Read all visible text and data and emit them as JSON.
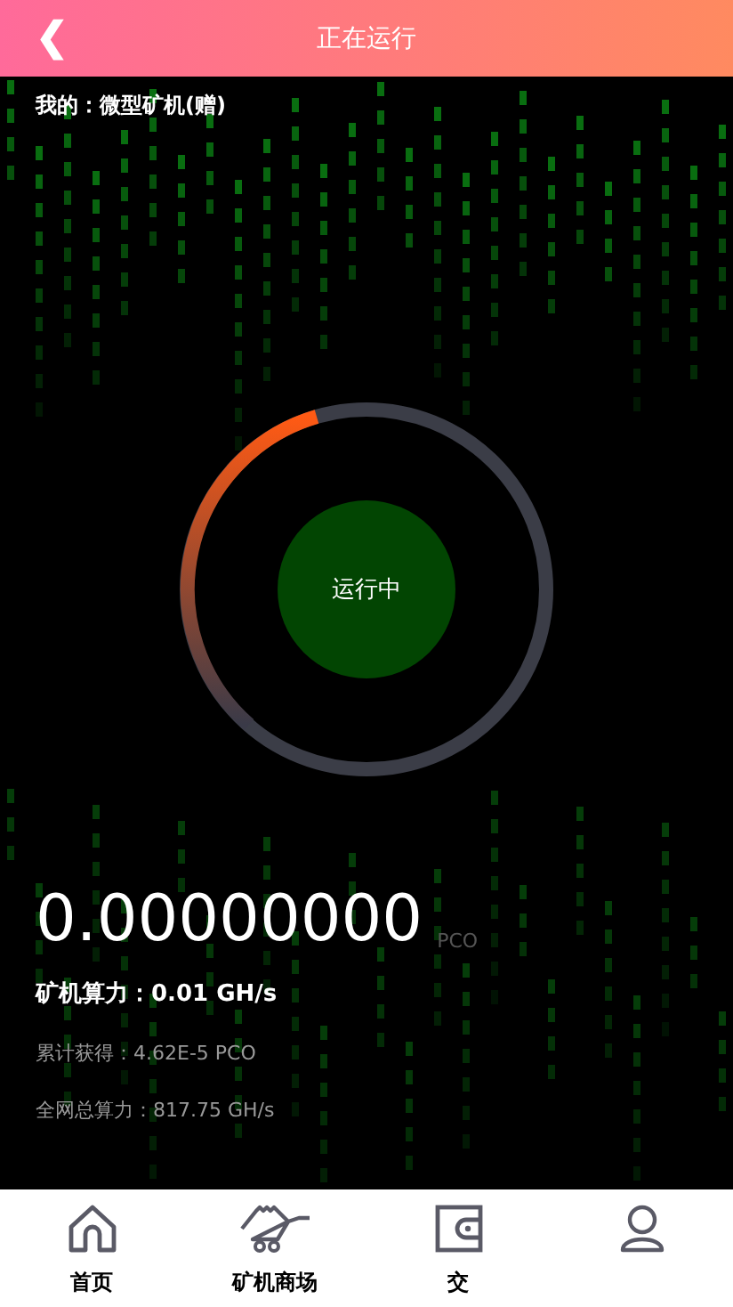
{
  "header": {
    "back_icon": "❮",
    "title": "正在运行"
  },
  "miner": {
    "label": "我的：",
    "name": "微型矿机(赠)"
  },
  "status": {
    "label": "运行中"
  },
  "balance": {
    "value": "0.00000000",
    "unit": "PCO"
  },
  "stats": [
    {
      "text": "矿机算力：0.01 GH/s",
      "kind": "primary"
    },
    {
      "text": "累计获得：4.62E-5 PCO",
      "kind": "secondary"
    },
    {
      "text": "全网总算力：817.75 GH/s",
      "kind": "secondary"
    }
  ],
  "tabbar": [
    {
      "label": "首页",
      "kind": "home"
    },
    {
      "label": "矿机商场",
      "kind": "cart"
    },
    {
      "label": "交",
      "kind": "wallet"
    },
    {
      "kind": "user"
    }
  ]
}
